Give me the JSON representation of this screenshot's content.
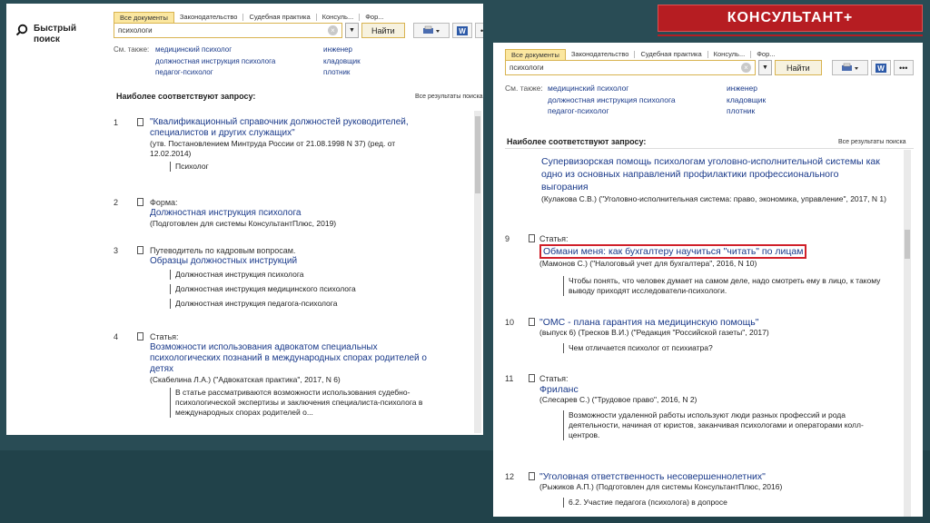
{
  "brand": "КОНСУЛЬТАНТ+",
  "panel1": {
    "quick_search": "Быстрый поиск",
    "tabs": [
      "Все документы",
      "Законодательство",
      "Судебная практика",
      "Консуль...",
      "Фор..."
    ],
    "search_value": "психологи",
    "find": "Найти",
    "see_also_label": "См. также:",
    "see_also_col1": [
      "медицинский психолог",
      "должностная инструкция психолога",
      "педагог-психолог"
    ],
    "see_also_col2": [
      "инженер",
      "кладовщик",
      "плотник"
    ],
    "best_match": "Наиболее соответствуют запросу:",
    "all_results": "Все результаты поиска",
    "results": [
      {
        "num": "1",
        "title": "\"Квалификационный справочник должностей руководителей, специалистов и других служащих\"",
        "source": "(утв. Постановлением Минтруда России от 21.08.1998 N 37) (ред. от 12.02.2014)",
        "snippets": [
          "Психолог"
        ]
      },
      {
        "num": "2",
        "type": "Форма:",
        "title": "Должностная инструкция психолога",
        "source": "(Подготовлен для системы КонсультантПлюс, 2019)",
        "snippets": []
      },
      {
        "num": "3",
        "type": "Путеводитель по кадровым вопросам.",
        "title": "Образцы должностных инструкций",
        "source": "",
        "snippets": [
          "Должностная инструкция психолога",
          "Должностная инструкция медицинского психолога",
          "Должностная инструкция педагога-психолога"
        ]
      },
      {
        "num": "4",
        "type": "Статья:",
        "title": "Возможности использования адвокатом специальных психологических познаний в международных спорах родителей о детях",
        "source": "(Скабелина Л.А.) (\"Адвокатская практика\", 2017, N 6)",
        "snippets": [
          "В статье рассматриваются возможности использования судебно-психологической экспертизы и заключения специалиста-психолога в международных спорах родителей о..."
        ]
      }
    ]
  },
  "panel2": {
    "tabs": [
      "Все документы",
      "Законодательство",
      "Судебная практика",
      "Консуль...",
      "Фор..."
    ],
    "search_value": "психологи",
    "find": "Найти",
    "see_also_label": "См. также:",
    "see_also_col1": [
      "медицинский психолог",
      "должностная инструкция психолога",
      "педагог-психолог"
    ],
    "see_also_col2": [
      "инженер",
      "кладовщик",
      "плотник"
    ],
    "best_match": "Наиболее соответствуют запросу:",
    "all_results": "Все результаты поиска",
    "top_partial": {
      "title": "Супервизорская помощь психологам уголовно-исполнительной системы как одно из основных направлений профилактики профессионального выгорания",
      "source": "(Кулакова С.В.) (\"Уголовно-исполнительная система: право, экономика, управление\", 2017, N 1)"
    },
    "results": [
      {
        "num": "9",
        "type": "Статья:",
        "title": "Обмани меня: как бухгалтеру научиться \"читать\" по лицам",
        "source": "(Мамонов С.) (\"Налоговый учет для бухгалтера\", 2016, N 10)",
        "snippets": [
          "Чтобы понять, что человек думает на самом деле, надо смотреть ему в лицо, к такому выводу приходят исследователи-психологи."
        ]
      },
      {
        "num": "10",
        "title": "\"ОМС - плана гарантия на медицинскую помощь\"",
        "source": "(выпуск 6) (Тресков В.И.) (\"Редакция \"Российской газеты\", 2017)",
        "snippets": [
          "Чем отличается психолог от психиатра?"
        ]
      },
      {
        "num": "11",
        "type": "Статья:",
        "title": "Фриланс",
        "source": "(Слесарев С.) (\"Трудовое право\", 2016, N 2)",
        "snippets": [
          "Возможности удаленной работы используют люди разных профессий и рода деятельности, начиная от юристов, заканчивая психологами и операторами колл-центров."
        ]
      },
      {
        "num": "12",
        "title": "\"Уголовная ответственность несовершеннолетних\"",
        "source": "(Рыжиков А.П.) (Подготовлен для системы КонсультантПлюс, 2016)",
        "snippets": [
          "6.2. Участие педагога (психолога) в допросе"
        ]
      }
    ]
  }
}
